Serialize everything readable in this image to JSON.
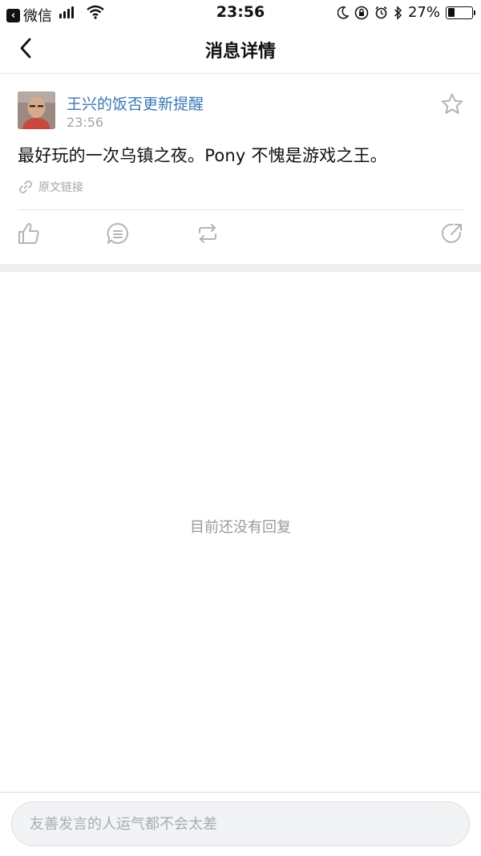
{
  "status_bar": {
    "back_app": "微信",
    "time": "23:56",
    "battery": "27%",
    "battery_level": 0.27
  },
  "nav": {
    "title": "消息详情"
  },
  "post": {
    "author": "王兴的饭否更新提醒",
    "time": "23:56",
    "content": "最好玩的一次乌镇之夜。Pony 不愧是游戏之王。",
    "source_link": "原文链接"
  },
  "replies": {
    "empty_text": "目前还没有回复"
  },
  "reply_input": {
    "placeholder": "友善发言的人运气都不会太差"
  },
  "colors": {
    "author": "#3c78b4",
    "muted": "#a4a4a4",
    "divider": "#e6e6e6"
  },
  "icons": [
    "back-arrow-icon",
    "star-icon",
    "link-icon",
    "thumbs-up-icon",
    "comment-icon",
    "repost-icon",
    "share-icon"
  ]
}
